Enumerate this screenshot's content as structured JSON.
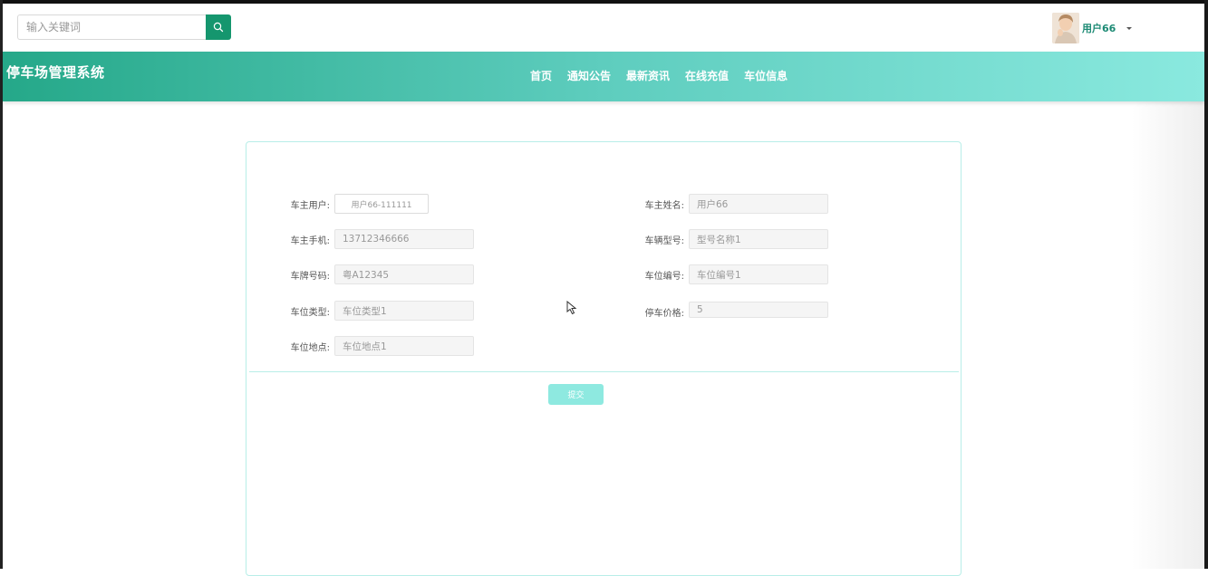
{
  "search": {
    "placeholder": "输入关键词",
    "icon": "search-icon",
    "button_color": "#15966e"
  },
  "user": {
    "name": "用户66",
    "name_color": "#1c8a74"
  },
  "header": {
    "title": "停车场管理系统",
    "gradient": [
      "#25a889",
      "#5ecdbe",
      "#8ae9df"
    ],
    "nav": [
      "首页",
      "通知公告",
      "最新资讯",
      "在线充值",
      "车位信息"
    ]
  },
  "form": {
    "fields": [
      {
        "label": "车主用户:",
        "value": "用户66-111111"
      },
      {
        "label": "车主姓名:",
        "value": "用户66"
      },
      {
        "label": "车主手机:",
        "value": "13712346666"
      },
      {
        "label": "车辆型号:",
        "value": "型号名称1"
      },
      {
        "label": "车牌号码:",
        "value": "粤A12345"
      },
      {
        "label": "车位编号:",
        "value": "车位编号1"
      },
      {
        "label": "车位类型:",
        "value": "车位类型1"
      },
      {
        "label": "停车价格:",
        "value": "5"
      },
      {
        "label": "车位地点:",
        "value": "车位地点1"
      }
    ],
    "submit_label": "提交",
    "border_color": "#b8eee8",
    "submit_color": "#8ee9e0"
  }
}
